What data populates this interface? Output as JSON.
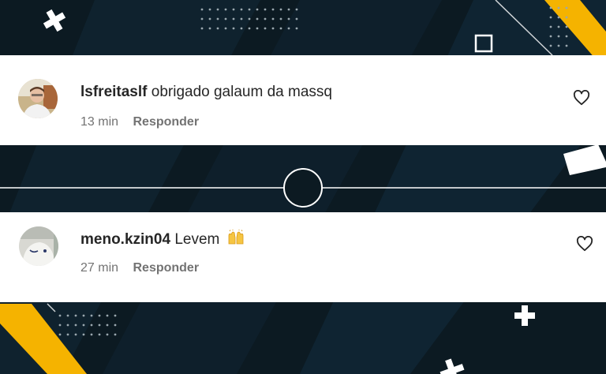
{
  "comments": [
    {
      "username": "lsfreitaslf",
      "text": "obrigado galaum da massq",
      "time": "13 min",
      "reply_label": "Responder",
      "avatar_icon": "user-avatar-photo",
      "like_icon": "heart-icon"
    },
    {
      "username": "meno.kzin04",
      "text": "Levem",
      "emoji_icon": "raising-hands-emoji",
      "time": "27 min",
      "reply_label": "Responder",
      "avatar_icon": "user-avatar-photo",
      "like_icon": "heart-icon"
    }
  ],
  "colors": {
    "background": "#0b1820",
    "accent": "#f5b300",
    "card": "#ffffff"
  }
}
